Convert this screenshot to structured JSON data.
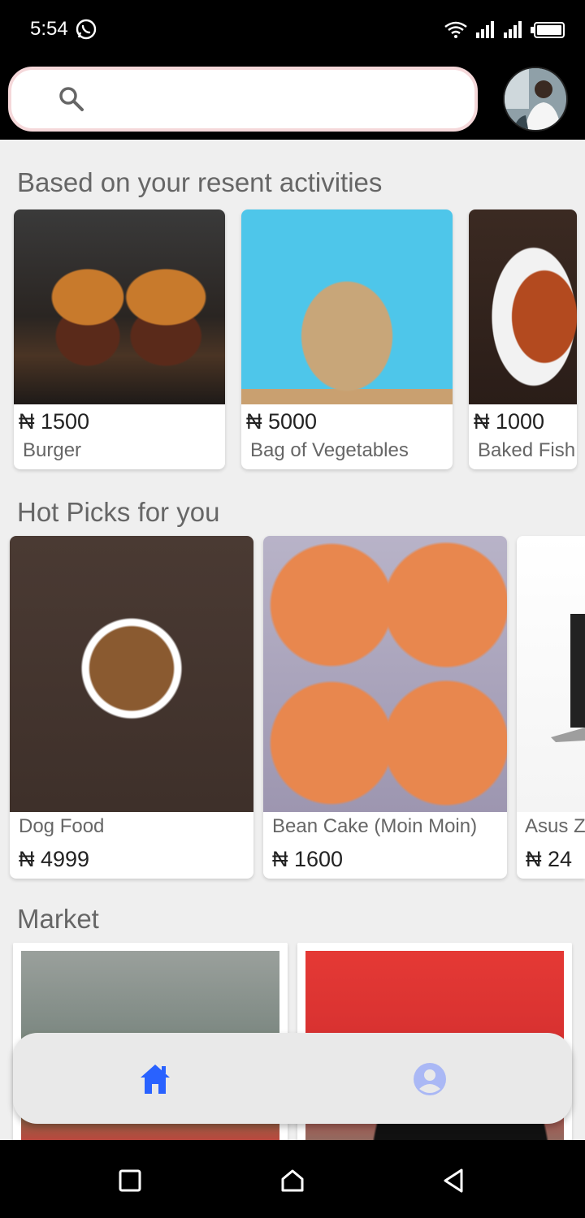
{
  "status_bar": {
    "time": "5:54",
    "icons": [
      "whatsapp-icon",
      "wifi-icon",
      "signal-icon",
      "signal-icon",
      "battery-icon"
    ]
  },
  "search": {
    "placeholder": "",
    "value": ""
  },
  "sections": {
    "recent": {
      "title": "Based on your resent activities",
      "items": [
        {
          "price": "₦ 1500",
          "name": "Burger"
        },
        {
          "price": "₦ 5000",
          "name": "Bag of Vegetables"
        },
        {
          "price": "₦ 1000",
          "name": "Baked Fish"
        }
      ]
    },
    "hot_picks": {
      "title": "Hot Picks for you",
      "items": [
        {
          "name": "Dog Food",
          "price": "₦ 4999"
        },
        {
          "name": "Bean Cake (Moin Moin)",
          "price": "₦ 1600"
        },
        {
          "name": "Asus Z",
          "price": "₦ 24"
        }
      ]
    },
    "market": {
      "title": "Market"
    }
  },
  "bottom_nav": {
    "items": [
      "home-icon",
      "profile-icon"
    ],
    "active_color": "#2962ff",
    "inactive_color": "#aab8f5"
  }
}
